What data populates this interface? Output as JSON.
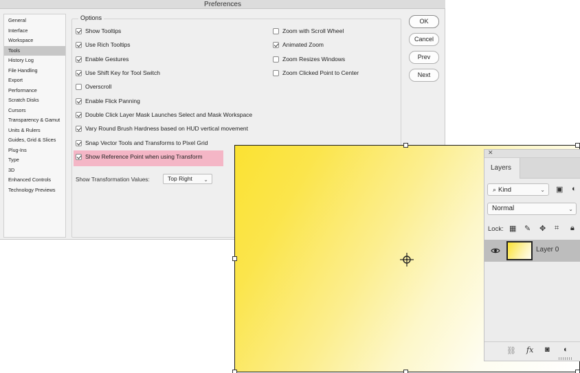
{
  "dialog": {
    "title": "Preferences",
    "nav_items": [
      "General",
      "Interface",
      "Workspace",
      "Tools",
      "History Log",
      "File Handling",
      "Export",
      "Performance",
      "Scratch Disks",
      "Cursors",
      "Transparency & Gamut",
      "Units & Rulers",
      "Guides, Grid & Slices",
      "Plug-Ins",
      "Type",
      "3D",
      "Enhanced Controls",
      "Technology Previews"
    ],
    "selected_nav": "Tools",
    "options_title": "Options",
    "left_options": [
      {
        "label": "Show Tooltips",
        "checked": true
      },
      {
        "label": "Use Rich Tooltips",
        "checked": true
      },
      {
        "label": "Enable Gestures",
        "checked": true
      },
      {
        "label": "Use Shift Key for Tool Switch",
        "checked": true
      },
      {
        "label": "Overscroll",
        "checked": false
      },
      {
        "label": "Enable Flick Panning",
        "checked": true
      },
      {
        "label": "Double Click Layer Mask Launches Select and Mask Workspace",
        "checked": true
      },
      {
        "label": "Vary Round Brush Hardness based on HUD vertical movement",
        "checked": true
      },
      {
        "label": "Snap Vector Tools and Transforms to Pixel Grid",
        "checked": true
      },
      {
        "label": "Show Reference Point when using Transform",
        "checked": true
      }
    ],
    "right_options": [
      {
        "label": "Zoom with Scroll Wheel",
        "checked": false
      },
      {
        "label": "Animated Zoom",
        "checked": true
      },
      {
        "label": "Zoom Resizes Windows",
        "checked": false
      },
      {
        "label": "Zoom Clicked Point to Center",
        "checked": false
      }
    ],
    "transform_values_label": "Show Transformation Values:",
    "transform_values_selected": "Top Right",
    "buttons": {
      "ok": "OK",
      "cancel": "Cancel",
      "prev": "Prev",
      "next": "Next"
    },
    "highlight_color": "#f4b6c6"
  },
  "layers_panel": {
    "tab": "Layers",
    "filter_kind": "Kind",
    "blend_mode": "Normal",
    "lock_label": "Lock:",
    "layer_name": "Layer 0"
  },
  "canvas": {
    "gradient_start": "#fbe232",
    "gradient_end": "#ffffff"
  }
}
